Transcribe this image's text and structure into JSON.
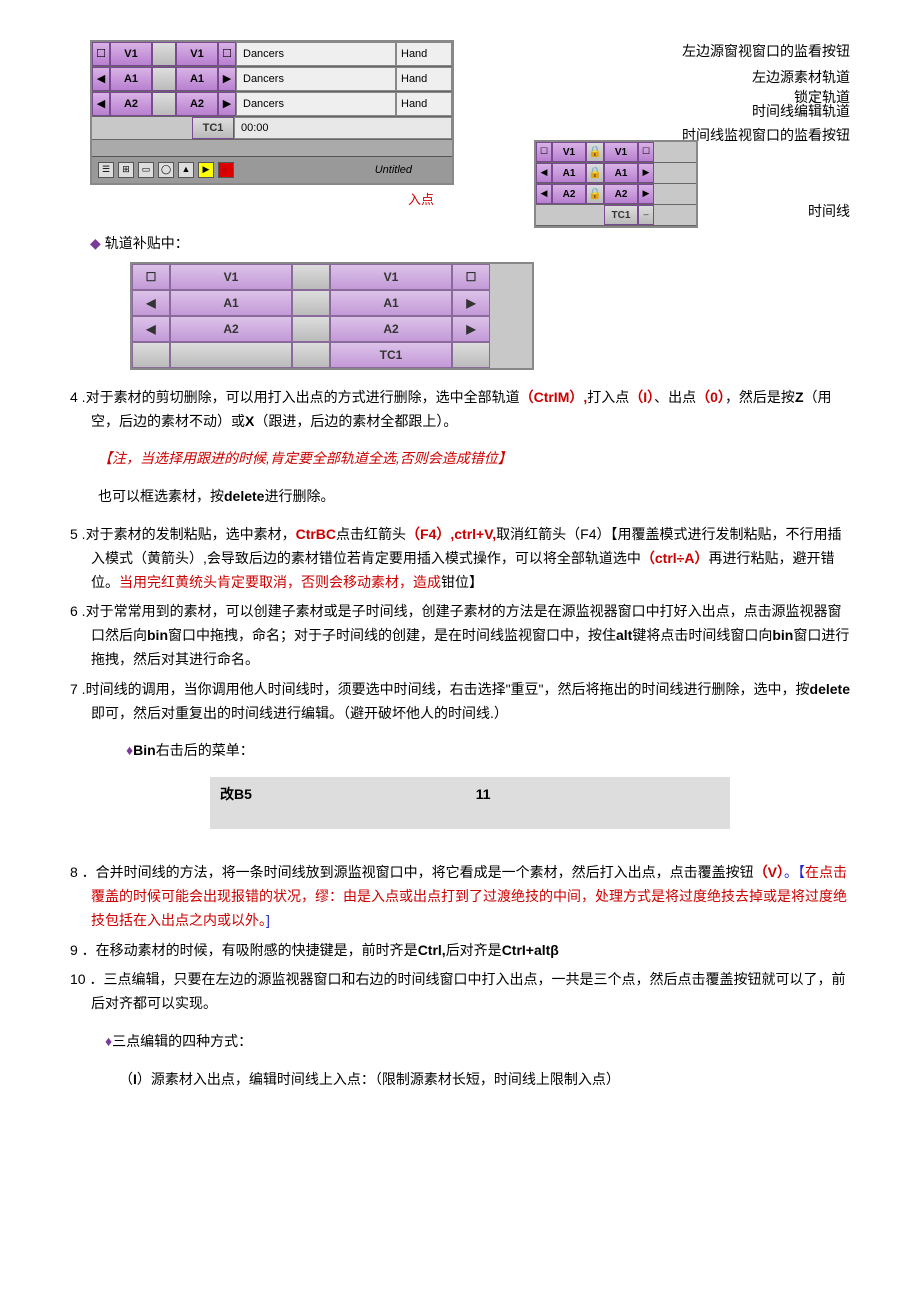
{
  "fig1": {
    "tracks": [
      "V1",
      "A1",
      "A2"
    ],
    "clip_name": "Dancers",
    "clip2": "Hand",
    "tc_label": "TC1",
    "tc_value": "00:00",
    "toolbar_title": "Untitled",
    "under_label": "入点"
  },
  "fig2": {
    "labels": {
      "a": "左边源窗视窗口的监看按钮",
      "b": "左边源素材轨道",
      "c": "锁定轨道",
      "d": "时间线编辑轨道",
      "e": "时间线监视窗口的监看按钮",
      "f": "时间线"
    },
    "tracks": [
      "V1",
      "A1",
      "A2",
      "TC1"
    ]
  },
  "section_track_patch": "轨道补贴中：",
  "fig3": {
    "rows": [
      [
        "",
        "V1",
        "",
        "V1",
        ""
      ],
      [
        "",
        "A1",
        "",
        "A1",
        ""
      ],
      [
        "",
        "A2",
        "",
        "A2",
        ""
      ],
      [
        "",
        "",
        "",
        "TC1",
        ""
      ]
    ]
  },
  "item4": {
    "lead": "4 .对于素材的剪切删除，可以用打入出点的方式进行删除，选中全部轨道",
    "p1": "（CtrIM）,",
    "p2": "打入点",
    "p3": "（I）",
    "p4": "、出点",
    "p5": "（0）",
    "p6": "，然后是按",
    "zk": "Z",
    "p7": "（用空，后边的素材不动）或",
    "xk": "X",
    "p8": "（跟进，后边的素材全都跟上）。",
    "note": "【注，当选择用跟进的时候,肯定要全部轨道全选,否则会造成错位】",
    "tail": "也可以框选素材，按delete进行删除。"
  },
  "item5": {
    "lead": "5 .对于素材的发制粘贴，选中素材，",
    "p1": "CtrBC",
    "p2": "点击红箭头",
    "p3": "（F4）,ctrl+V,",
    "p4": "取消红箭头（F4）【用覆盖模式进行发制粘贴，不行用插入模式（黄箭头）,会导致后边的素材错位若肯定要用插入模式操作，可以将全部轨道选中",
    "p5": "（ctrl÷A）",
    "p6": "再进行粘贴，避开错位。",
    "note": "当用完红黄统头肯定要取消，否则会移动素材，造成",
    "tail": "钳位】"
  },
  "item6": "6 .对于常常用到的素材，可以创建子素材或是子时间线，创建子素材的方法是在源监视器窗口中打好入出点，点击源监视器窗口然后向bin窗口中拖拽，命名；对于子时间线的创建，是在时间线监视窗口中，按住alt键将点击时间线窗口向bin窗口进行拖拽，然后对其进行命名。",
  "item7": {
    "text": "7 .时间线的调用，当你调用他人时间线时，须要选中时间线，右击选择\"重豆\"，然后将拖出的时间线进行删除，选中，按delete即可，然后对重复出的时间线进行编辑。（避开破坏他人的时间线.）",
    "sub": "♦Bin右击后的菜单："
  },
  "greybox": {
    "left": "改B5",
    "right": "11"
  },
  "item8": {
    "lead": "8 ．合并时间线的方法，将一条时间线放到源监视窗口中，将它看成是一个素材，然后打入出点，点击覆盖按钮",
    "v": "（V）",
    "rest": "。【在点击覆盖的时候可能会出现报错的状况，缪：由是入点或出点打到了过渡绝技的中间，处理方式是将过度绝技去掉或是将过度绝技包括在入出点之内或以外。]"
  },
  "item9": {
    "lead": "9 ．在移动素材的时候，有吸附感的快捷键是，前时齐是",
    "c1": "Ctrl,",
    "mid": "后对齐是",
    "c2": "CtrI+altβ"
  },
  "item10": {
    "text": "10 ．三点编辑，只要在左边的源监视器窗口和右边的时间线窗口中打入出点，一共是三个点，然后点击覆盖按钮就可以了，前后对齐都可以实现。",
    "sub": "♦三点编辑的四种方式：",
    "line": "（I）源素材入出点，编辑时间线上入点：（限制源素材长短，时间线上限制入点）"
  }
}
